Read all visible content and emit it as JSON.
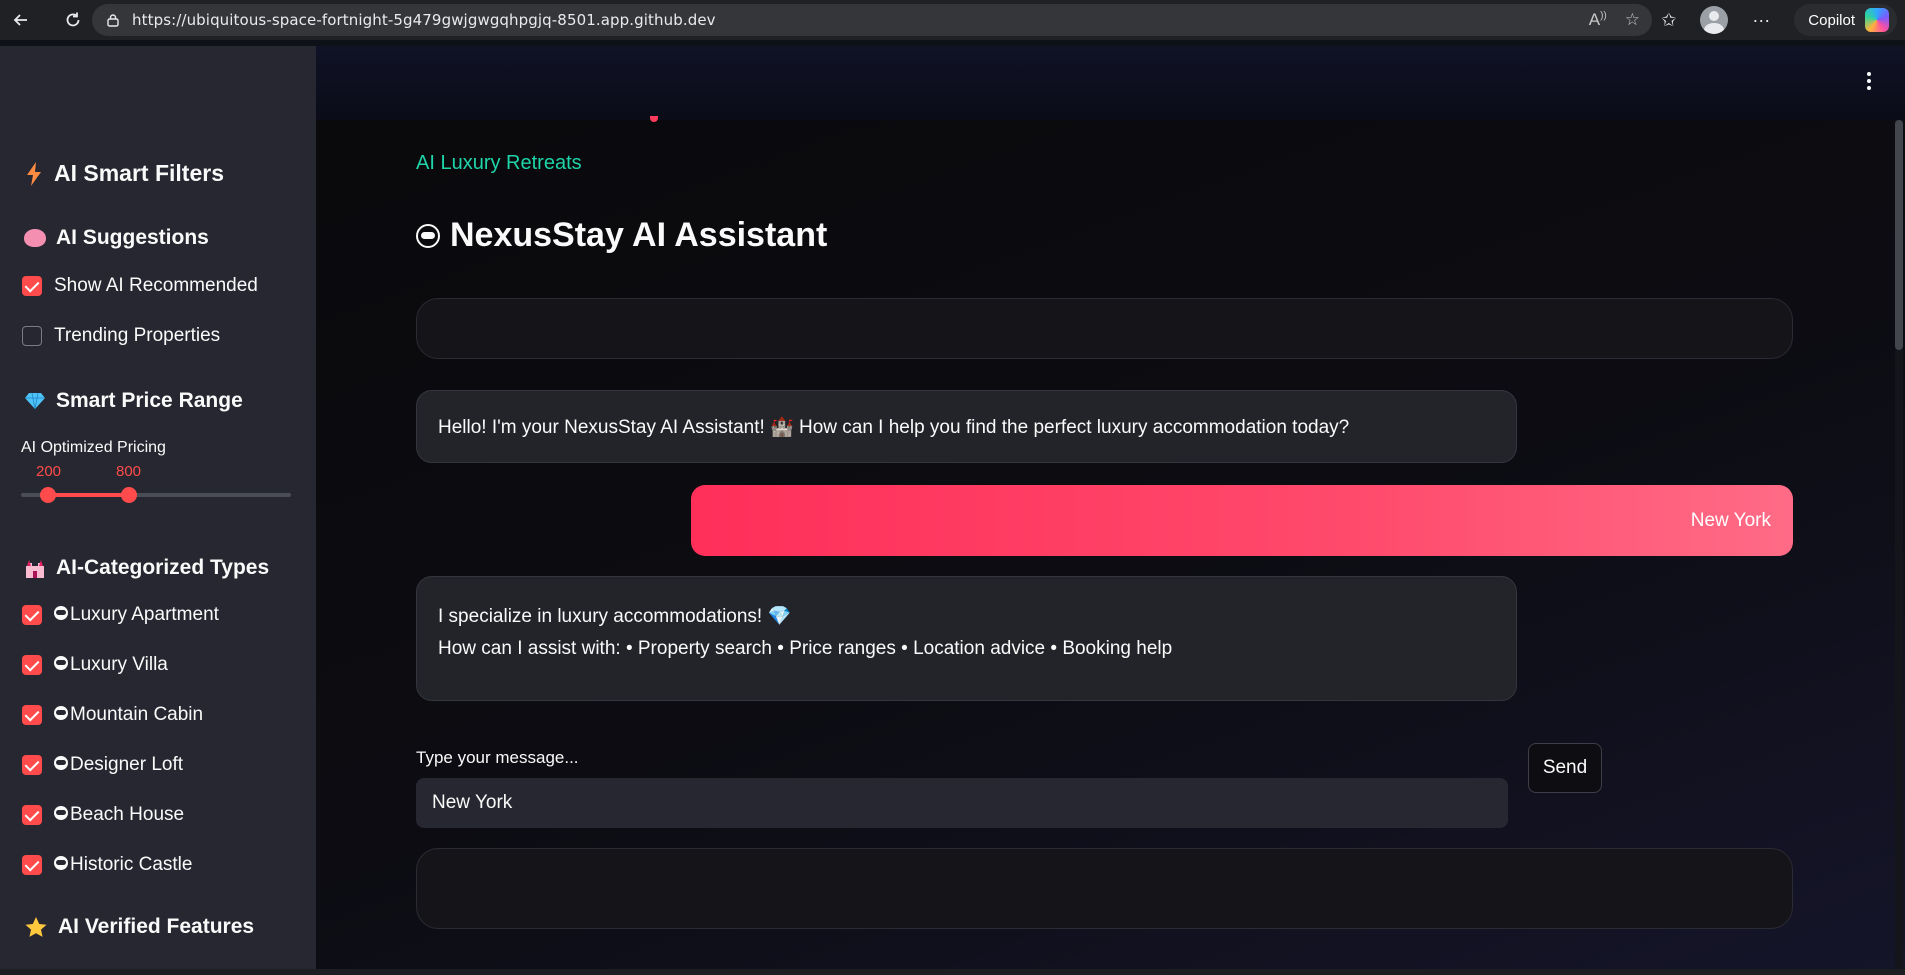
{
  "browser": {
    "url": "https://ubiquitous-space-fortnight-5g479gwjgwgqhpgjq-8501.app.github.dev",
    "copilot_label": "Copilot"
  },
  "sidebar": {
    "title": "AI Smart Filters",
    "suggestions": {
      "heading": "AI Suggestions",
      "options": [
        {
          "label": "Show AI Recommended",
          "checked": true
        },
        {
          "label": "Trending Properties",
          "checked": false
        }
      ]
    },
    "price": {
      "heading": "Smart Price Range",
      "slider_label": "AI Optimized Pricing",
      "low_value": "200",
      "high_value": "800"
    },
    "types": {
      "heading": "AI-Categorized Types",
      "options": [
        {
          "label": "Luxury Apartment",
          "checked": true
        },
        {
          "label": "Luxury Villa",
          "checked": true
        },
        {
          "label": "Mountain Cabin",
          "checked": true
        },
        {
          "label": "Designer Loft",
          "checked": true
        },
        {
          "label": "Beach House",
          "checked": true
        },
        {
          "label": "Historic Castle",
          "checked": true
        }
      ]
    },
    "features_heading": "AI Verified Features"
  },
  "main": {
    "subtitle": "AI Luxury Retreats",
    "title": "NexusStay AI Assistant",
    "messages": [
      {
        "role": "assistant",
        "text": "Hello! I'm your NexusStay AI Assistant! 🏰 How can I help you find the perfect luxury accommodation today?"
      },
      {
        "role": "user",
        "text": "New York"
      },
      {
        "role": "assistant",
        "line1": "I specialize in luxury accommodations! 💎",
        "line2": "How can I assist with: • Property search • Price ranges • Location advice • Booking help"
      }
    ],
    "input_label": "Type your message...",
    "input_value": "New York",
    "send_label": "Send"
  },
  "colors": {
    "accent": "#ff4b4b",
    "subtitle": "#1fd4a8",
    "user_bubble": "#ff3b5c"
  }
}
